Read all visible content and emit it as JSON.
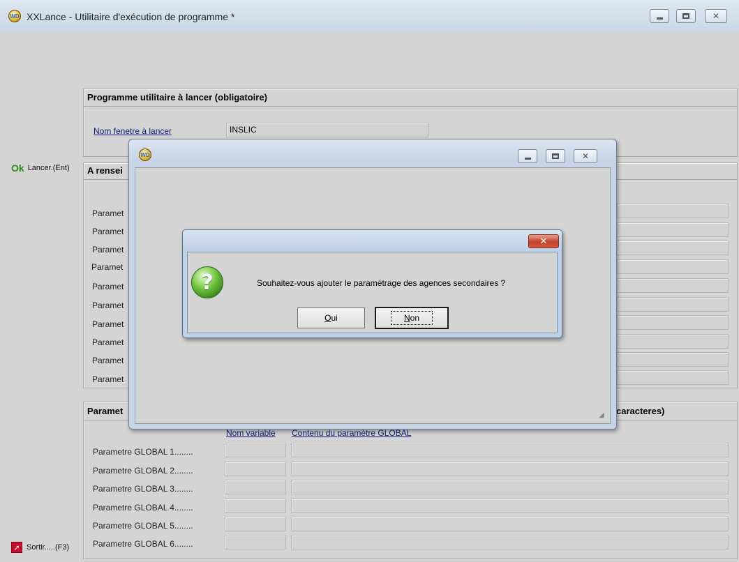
{
  "main_window": {
    "title": "XXLance - Utilitaire d'exécution de programme *",
    "icon": "wd-app-icon",
    "caption_buttons": [
      "minimize",
      "maximize",
      "close"
    ]
  },
  "sidebar": {
    "ok_glyph": "Ok",
    "launch_label": "Lancer.(Ent)",
    "exit_label": "Sortir.....(F3)",
    "exit_icon": "exit-icon"
  },
  "program_group": {
    "title": "Programme utilitaire à lancer  (obligatoire)",
    "window_name_label": "Nom fenetre à lancer",
    "window_name_value": "INSLIC"
  },
  "params_group": {
    "title_fragment": "A rensei",
    "rows": [
      "Paramet",
      "Paramet",
      "Paramet",
      "Paramet",
      "Paramet",
      "Paramet",
      "Paramet",
      "Paramet",
      "Paramet",
      "Paramet"
    ]
  },
  "global_group": {
    "title_left": "Paramet",
    "title_right": "caracteres)",
    "col_name_header": "Nom variable",
    "col_content_header": "Contenu du paramètre GLOBAL",
    "rows": [
      {
        "label": "Parametre GLOBAL 1........",
        "name": "",
        "content": ""
      },
      {
        "label": "Parametre GLOBAL 2........",
        "name": "",
        "content": ""
      },
      {
        "label": "Parametre GLOBAL 3........",
        "name": "",
        "content": ""
      },
      {
        "label": "Parametre GLOBAL 4........",
        "name": "",
        "content": ""
      },
      {
        "label": "Parametre GLOBAL 5........",
        "name": "",
        "content": ""
      },
      {
        "label": "Parametre GLOBAL 6........",
        "name": "",
        "content": ""
      }
    ]
  },
  "secondary_window": {
    "icon": "wd-app-icon",
    "caption_buttons": [
      "minimize",
      "maximize",
      "close"
    ]
  },
  "dialog": {
    "message": "Souhaitez-vous ajouter le paramétrage des agences secondaires ?",
    "icon": "question-icon",
    "close_glyph": "✕",
    "yes_label": "Oui",
    "no_label": "Non",
    "default_button": "Non"
  }
}
